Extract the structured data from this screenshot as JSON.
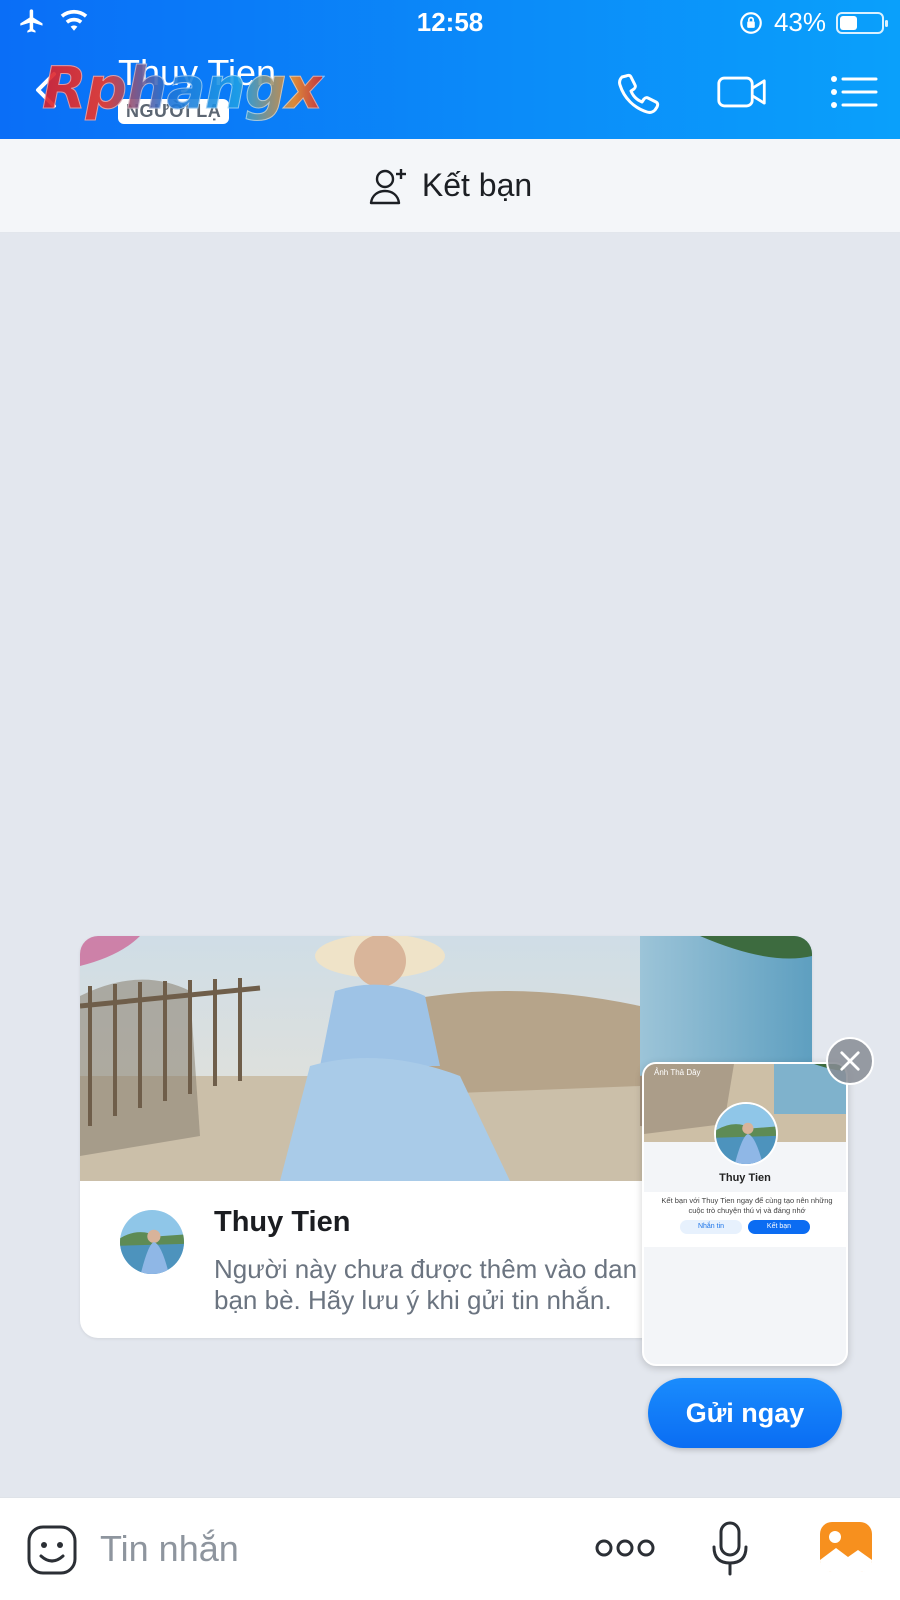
{
  "status_bar": {
    "time": "12:58",
    "battery": "43%",
    "icons": [
      "airplane-icon",
      "wifi-icon",
      "orientation-lock-icon",
      "battery-icon"
    ]
  },
  "header": {
    "name": "Thuy Tien",
    "badge": "NGƯỜI LẠ",
    "watermark": "Rphangx",
    "icons": [
      "back-icon",
      "phone-icon",
      "video-call-icon",
      "menu-list-icon"
    ]
  },
  "add_friend": {
    "label": "Kết bạn",
    "icon": "add-user-icon"
  },
  "profile_card": {
    "name": "Thuy Tien",
    "description_line1": "Người này chưa được thêm vào dan",
    "description_line2": "bạn bè. Hãy lưu ý khi gửi tin nhắn."
  },
  "preview": {
    "cover_label": "Ảnh Thả Dây",
    "name": "Thuy Tien",
    "text": "Kết bạn với Thuy Tien ngay để cùng tạo nên những cuộc trò chuyện thú vị và đáng nhớ",
    "message_button": "Nhắn tin",
    "add_button": "Kết bạn"
  },
  "send_now": "Gửi ngay",
  "composer": {
    "placeholder": "Tin nhắn",
    "icons": [
      "emoji-icon",
      "more-icon",
      "microphone-icon",
      "image-icon"
    ]
  },
  "colors": {
    "header_blue": "#0b8df9",
    "accent": "#0a6df3",
    "chat_bg": "#e3e7ee",
    "image_icon": "#f7901e"
  }
}
